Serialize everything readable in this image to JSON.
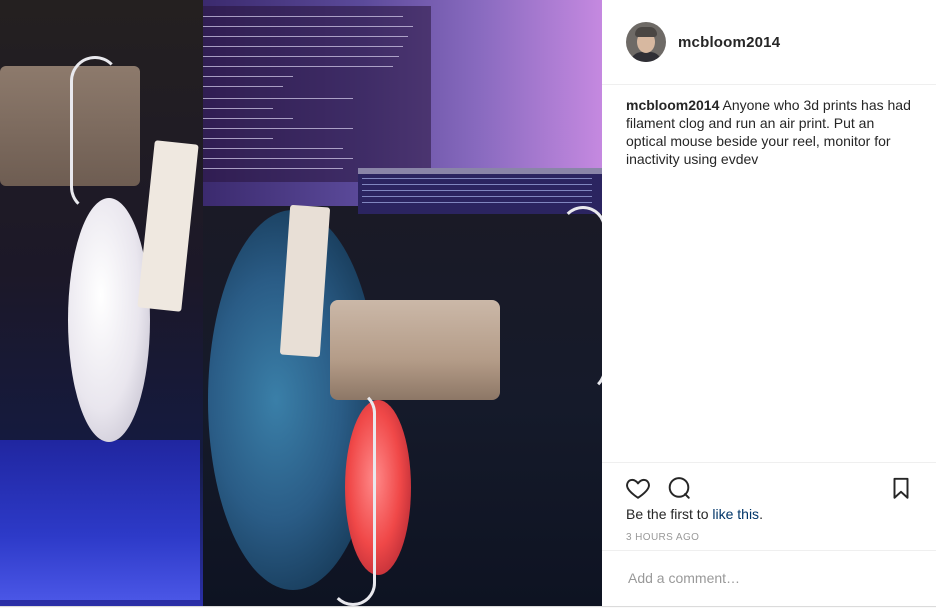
{
  "post": {
    "username": "mcbloom2014",
    "caption": {
      "username": "mcbloom2014",
      "text": "Anyone who 3d prints has had filament clog and run an air print. Put an optical mouse beside your reel, monitor for inactivity using evdev"
    },
    "likes": {
      "prefix": "Be the first to",
      "link": "like this",
      "suffix": "."
    },
    "timestamp": "3 HOURS AGO",
    "comment": {
      "placeholder": "Add a comment…",
      "value": ""
    },
    "icons": {
      "like": "heart-icon",
      "comment": "comment-bubble-icon",
      "save": "bookmark-icon"
    }
  }
}
